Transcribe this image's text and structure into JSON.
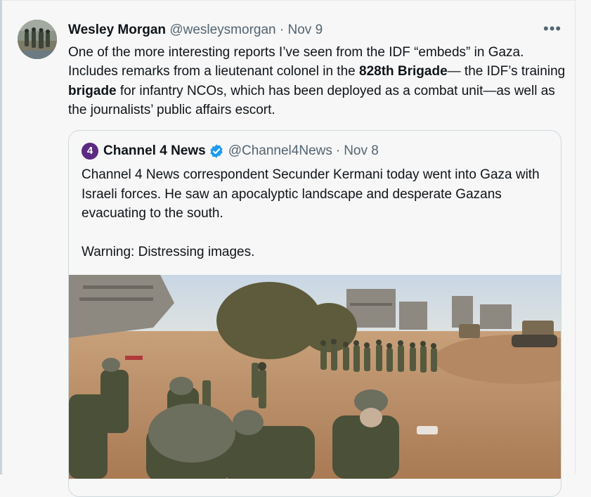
{
  "tweet": {
    "author_name": "Wesley Morgan",
    "handle": "@wesleysmorgan",
    "separator": "·",
    "date": "Nov 9",
    "more_icon": "more-horizontal-icon",
    "text_parts": [
      "One of the more interesting reports I’ve seen from the IDF “embeds” in Gaza. Includes remarks from a lieutenant colonel in the ",
      "828th Brigade",
      "— the IDF’s training ",
      "brigade",
      " for infantry NCOs, which has been deployed as a combat unit—as well as the journalists’ public affairs escort."
    ]
  },
  "quoted": {
    "logo_glyph": "4",
    "name": "Channel 4 News",
    "verified_icon": "verified-badge-icon",
    "handle": "@Channel4News",
    "separator": "·",
    "date": "Nov 8",
    "text_line1": "Channel 4 News correspondent Secunder Kermani today went into Gaza with Israeli forces. He saw an apocalyptic landscape and desperate Gazans evacuating to the south.",
    "text_line2": "Warning: Distressing images."
  },
  "colors": {
    "verified_blue": "#1d9bf0",
    "channel4_purple": "#5a2a82",
    "secondary_text": "#536471"
  }
}
